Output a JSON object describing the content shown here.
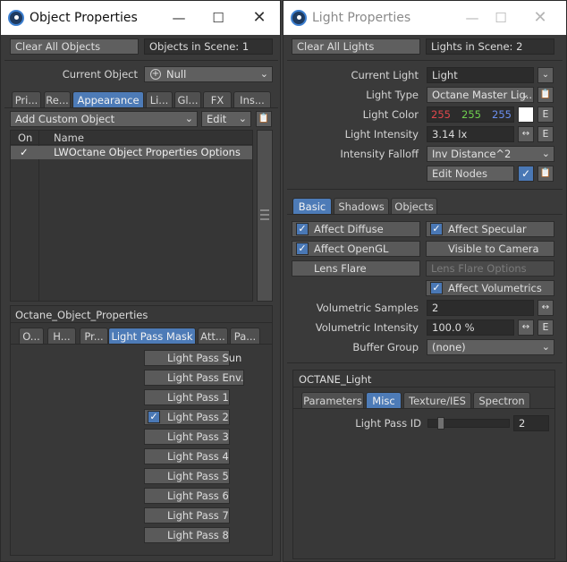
{
  "left_window": {
    "title": "Object Properties",
    "clear_btn": "Clear All Objects",
    "objects_count": "Objects in Scene: 1",
    "current_object_label": "Current Object",
    "current_object_value": "Null",
    "tabs": [
      "Pri...",
      "Re...",
      "Appearance",
      "Li...",
      "Gl...",
      "FX",
      "Ins..."
    ],
    "add_custom_object": "Add Custom Object",
    "edit": "Edit",
    "list": {
      "col_on": "On",
      "col_name": "Name",
      "rows": [
        {
          "on": "✓",
          "name": "LWOctane Object Properties Options"
        }
      ]
    },
    "section_title": "Octane_Object_Properties",
    "subtabs": [
      "O...",
      "H...",
      "Pr...",
      "Light Pass Mask",
      "Att...",
      "Pa..."
    ],
    "passes": [
      {
        "label": "Light Pass Sun",
        "checked": false
      },
      {
        "label": "Light Pass Env.",
        "checked": false
      },
      {
        "label": "Light Pass 1",
        "checked": false
      },
      {
        "label": "Light Pass 2",
        "checked": true
      },
      {
        "label": "Light Pass 3",
        "checked": false
      },
      {
        "label": "Light Pass 4",
        "checked": false
      },
      {
        "label": "Light Pass 5",
        "checked": false
      },
      {
        "label": "Light Pass 6",
        "checked": false
      },
      {
        "label": "Light Pass 7",
        "checked": false
      },
      {
        "label": "Light Pass 8",
        "checked": false
      }
    ]
  },
  "right_window": {
    "title": "Light Properties",
    "clear_btn": "Clear All Lights",
    "lights_count": "Lights in Scene: 2",
    "current_light_label": "Current Light",
    "current_light_value": "Light",
    "light_type_label": "Light Type",
    "light_type_value": "Octane Master Lig...",
    "light_color_label": "Light Color",
    "color_r": "255",
    "color_g": "255",
    "color_b": "255",
    "light_intensity_label": "Light Intensity",
    "light_intensity_value": "3.14 lx",
    "intensity_falloff_label": "Intensity Falloff",
    "intensity_falloff_value": "Inv Distance^2",
    "edit_nodes": "Edit Nodes",
    "e_label": "E",
    "tabs": [
      "Basic",
      "Shadows",
      "Objects"
    ],
    "affect_diffuse": "Affect Diffuse",
    "affect_specular": "Affect Specular",
    "affect_opengl": "Affect OpenGL",
    "visible_to_camera": "Visible to Camera",
    "lens_flare": "Lens Flare",
    "lens_flare_options": "Lens Flare Options",
    "affect_volumetrics": "Affect Volumetrics",
    "vol_samples_label": "Volumetric Samples",
    "vol_samples_value": "2",
    "vol_intensity_label": "Volumetric Intensity",
    "vol_intensity_value": "100.0 %",
    "buffer_group_label": "Buffer Group",
    "buffer_group_value": "(none)",
    "section_title": "OCTANE_Light",
    "subtabs": [
      "Parameters",
      "Misc",
      "Texture/IES",
      "Spectron"
    ],
    "light_pass_id_label": "Light Pass ID",
    "light_pass_id_value": "2"
  },
  "colors": {
    "accent": "#4d7bb7",
    "red": "#e0474c",
    "green": "#6fd04f",
    "blue": "#6b8ff0"
  }
}
